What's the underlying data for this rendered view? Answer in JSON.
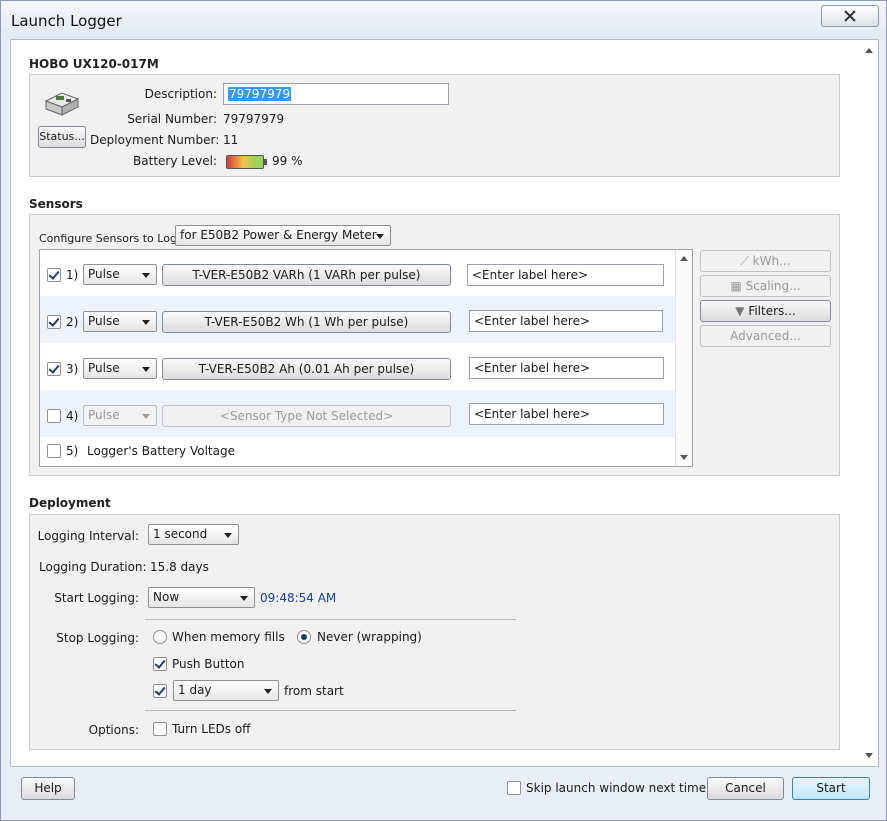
{
  "window": {
    "title": "Launch Logger"
  },
  "logger": {
    "model": "HOBO UX120-017M",
    "status_button": "Status...",
    "description_label": "Description:",
    "description_value": "79797979",
    "serial_label": "Serial Number:",
    "serial_value": "79797979",
    "deployment_label": "Deployment Number:",
    "deployment_value": "11",
    "battery_label": "Battery Level:",
    "battery_value": "99 %",
    "battery_fraction": 0.99
  },
  "sensors": {
    "section_title": "Sensors",
    "configure_label": "Configure Sensors to Log:",
    "configure_value": "for E50B2 Power & Energy Meter",
    "rows": [
      {
        "index": "1)",
        "checked": true,
        "mode": "Pulse",
        "type": "T-VER-E50B2 VARh (1 VARh per pulse)",
        "label": "<Enter label here>",
        "enabled": true
      },
      {
        "index": "2)",
        "checked": true,
        "mode": "Pulse",
        "type": "T-VER-E50B2 Wh (1 Wh per pulse)",
        "label": "<Enter label here>",
        "enabled": true
      },
      {
        "index": "3)",
        "checked": true,
        "mode": "Pulse",
        "type": "T-VER-E50B2 Ah (0.01 Ah per pulse)",
        "label": "<Enter label here>",
        "enabled": true
      },
      {
        "index": "4)",
        "checked": false,
        "mode": "Pulse",
        "type": "<Sensor Type Not Selected>",
        "label": "<Enter label here>",
        "enabled": false
      }
    ],
    "battery_row": {
      "index": "5)",
      "checked": false,
      "text": "Logger's Battery Voltage"
    },
    "side_buttons": {
      "kwh": "kWh...",
      "scaling": "Scaling...",
      "filters": "Filters...",
      "advanced": "Advanced..."
    }
  },
  "deployment": {
    "section_title": "Deployment",
    "interval_label": "Logging Interval:",
    "interval_value": "1 second",
    "duration_label": "Logging Duration:",
    "duration_value": "15.8 days",
    "start_label": "Start Logging:",
    "start_value": "Now",
    "start_time": "09:48:54 AM",
    "stop_label": "Stop Logging:",
    "stop_memory": "When memory fills",
    "stop_never": "Never (wrapping)",
    "push_button": "Push Button",
    "after_value": "1 day",
    "after_suffix": "from start",
    "options_label": "Options:",
    "leds_label": "Turn LEDs off"
  },
  "footer": {
    "help": "Help",
    "skip_label": "Skip launch window next time",
    "cancel": "Cancel",
    "start": "Start"
  },
  "colors": {
    "time_text": "#1a3fa8",
    "selection": "#3399ff",
    "accent_button": "#bee6fd"
  }
}
